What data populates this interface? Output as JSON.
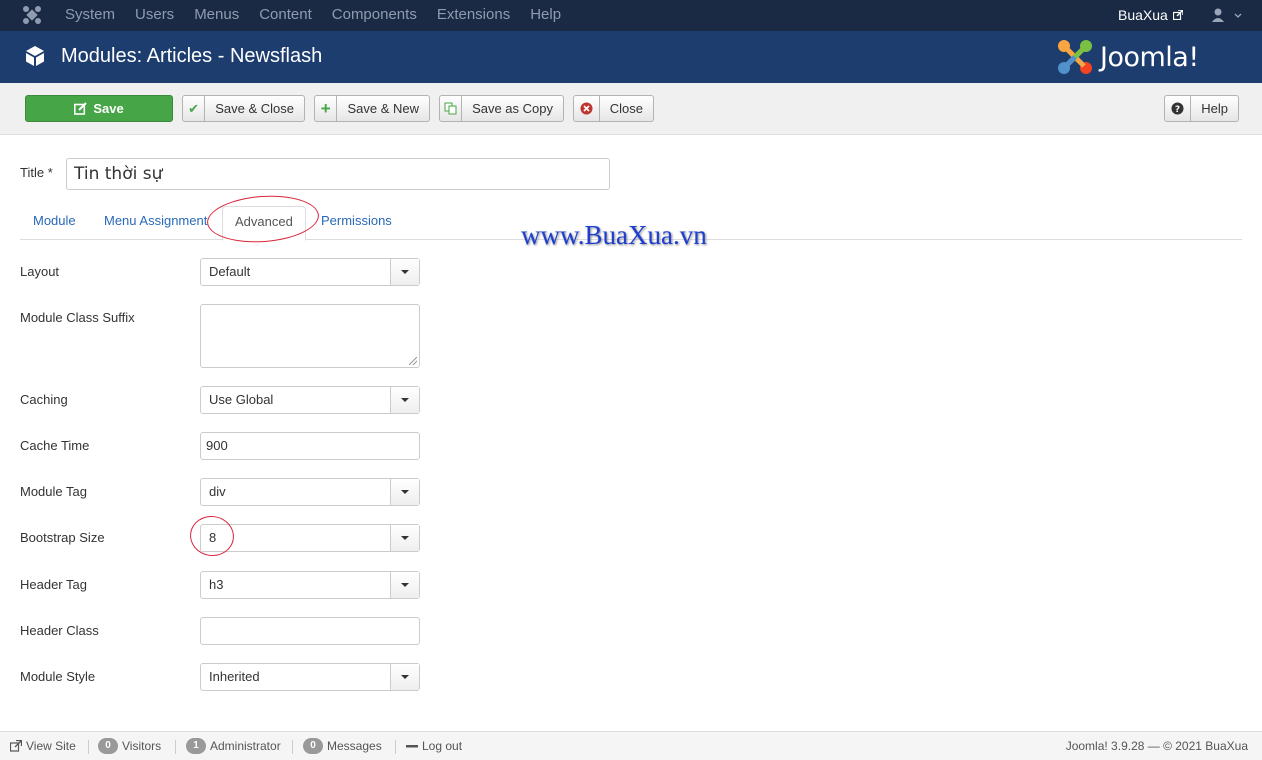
{
  "topbar": {
    "menu": [
      "System",
      "Users",
      "Menus",
      "Content",
      "Components",
      "Extensions",
      "Help"
    ],
    "username": "BuaXua"
  },
  "header": {
    "title": "Modules: Articles - Newsflash",
    "brand": "Joomla!"
  },
  "toolbar": {
    "save": "Save",
    "save_close": "Save & Close",
    "save_new": "Save & New",
    "save_copy": "Save as Copy",
    "close": "Close",
    "help": "Help"
  },
  "form": {
    "title_label": "Title *",
    "title_value": "Tin thời sự",
    "tabs": [
      "Module",
      "Menu Assignment",
      "Advanced",
      "Permissions"
    ],
    "active_tab": "Advanced",
    "fields": {
      "layout": {
        "label": "Layout",
        "value": "Default"
      },
      "module_class_suffix": {
        "label": "Module Class Suffix",
        "value": ""
      },
      "caching": {
        "label": "Caching",
        "value": "Use Global"
      },
      "cache_time": {
        "label": "Cache Time",
        "value": "900"
      },
      "module_tag": {
        "label": "Module Tag",
        "value": "div"
      },
      "bootstrap_size": {
        "label": "Bootstrap Size",
        "value": "8"
      },
      "header_tag": {
        "label": "Header Tag",
        "value": "h3"
      },
      "header_class": {
        "label": "Header Class",
        "value": ""
      },
      "module_style": {
        "label": "Module Style",
        "value": "Inherited"
      }
    }
  },
  "watermark": "www.BuaXua.vn",
  "status": {
    "view_site": "View Site",
    "visitors_count": "0",
    "visitors": "Visitors",
    "admin_count": "1",
    "administrator": "Administrator",
    "messages_count": "0",
    "messages": "Messages",
    "logout": "Log out",
    "version": "Joomla! 3.9.28  —  © 2021 BuaXua"
  },
  "colors": {
    "topbar": "#1a2a44",
    "titlebar": "#1c3d6e",
    "save_button": "#46a546",
    "link": "#2a69b8",
    "annotation_circle": "#d9263b"
  }
}
